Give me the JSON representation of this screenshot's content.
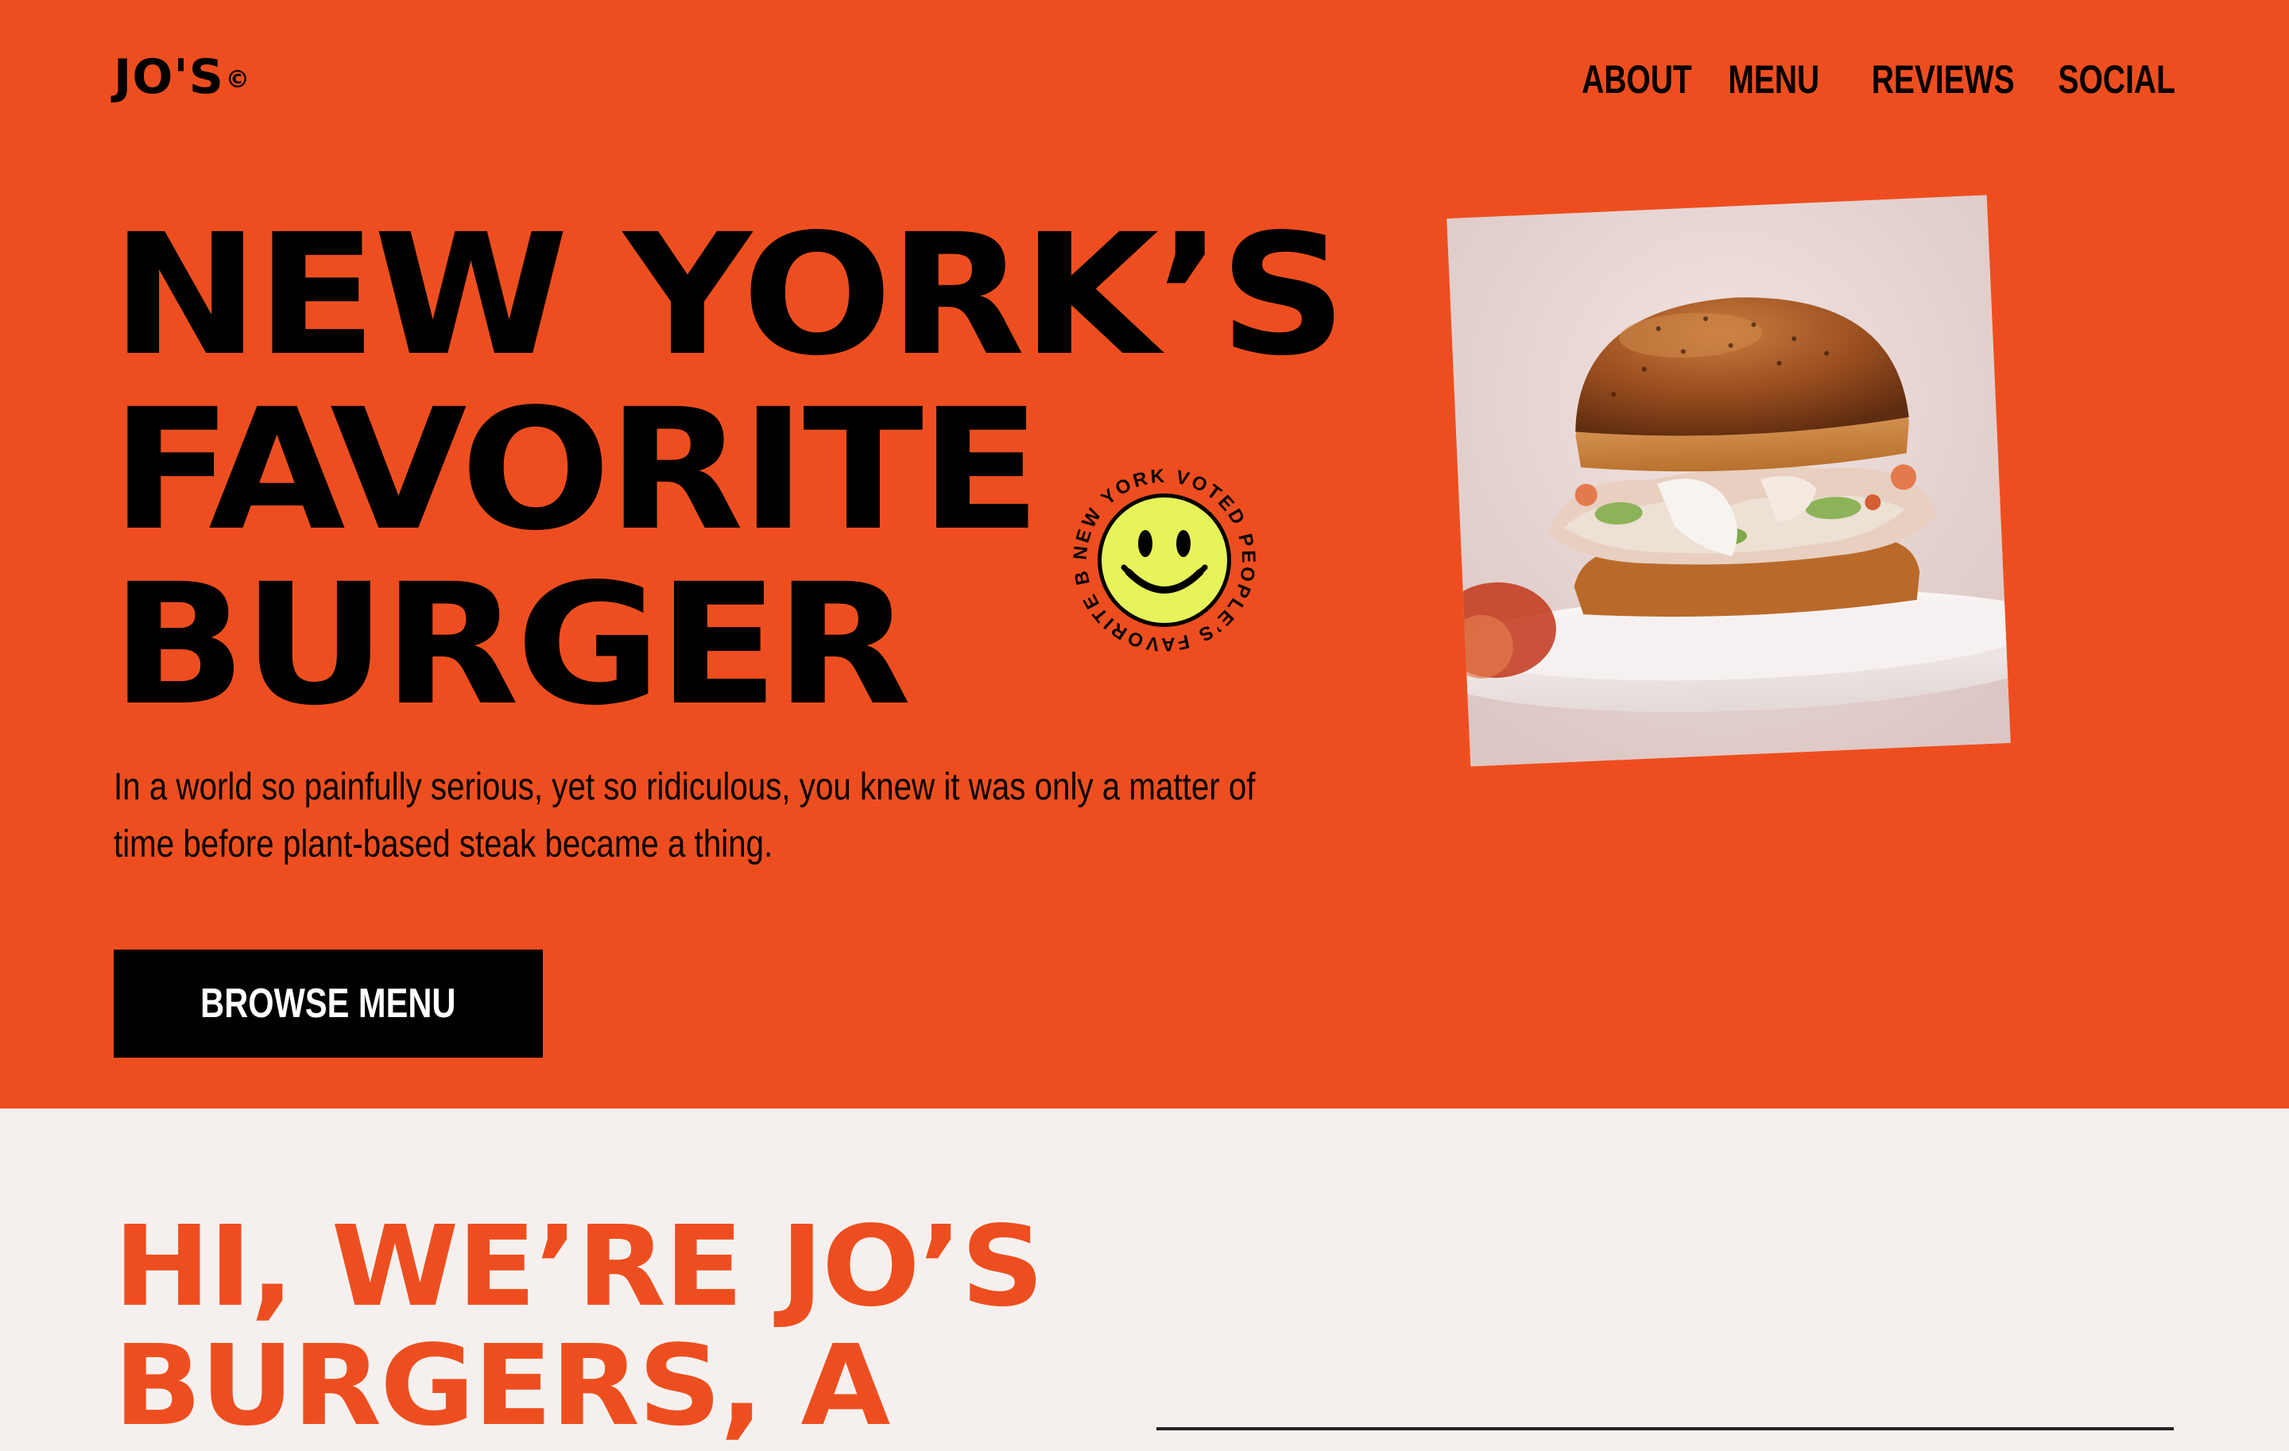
{
  "brand": {
    "logo": "JO'S",
    "logo_mark": "©"
  },
  "nav": {
    "items": [
      "ABOUT",
      "MENU",
      "REVIEWS",
      "SOCIAL"
    ]
  },
  "hero": {
    "headline_lines": [
      "NEW YORK’S",
      "FAVORITE",
      "BURGER"
    ],
    "badge_text": "NEW YORK VOTED PEOPLE’S FAVORITE BURGER IN ",
    "intro": "In a world so painfully serious, yet so ridiculous, you knew it was only a matter of time before plant-based steak became a thing.",
    "cta_label": "BROWSE MENU"
  },
  "about": {
    "title_lines": [
      "HI, WE’RE JO’S",
      "BURGERS, A"
    ]
  },
  "colors": {
    "accent": "#EE4E1F",
    "ink": "#000000",
    "paper": "#F5F0EE",
    "smiley": "#E6F45A"
  },
  "icons": {
    "badge": "smiley-face-icon"
  }
}
